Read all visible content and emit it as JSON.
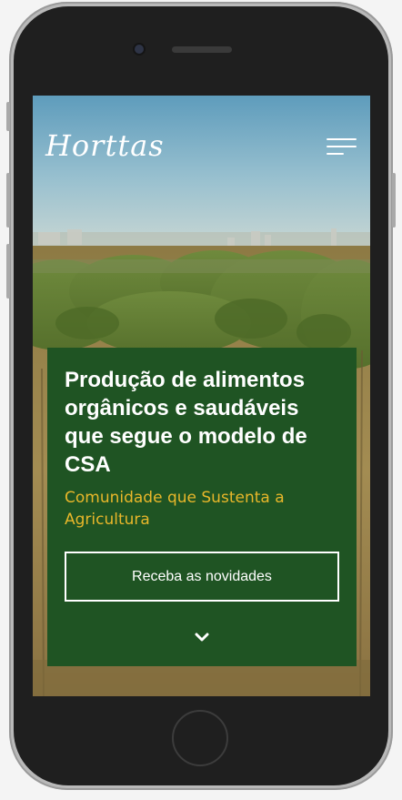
{
  "app": {
    "logo_text": "Horttas"
  },
  "header": {
    "menu_icon": "hamburger-menu-icon"
  },
  "hero": {
    "headline": "Produção de alimentos orgânicos e saudáveis que segue o modelo de CSA",
    "subtitle": "Comunidade que Sustenta a Agricultura",
    "cta_label": "Receba as novidades",
    "scroll_icon": "chevron-down-icon"
  },
  "colors": {
    "card_background": "#1f5423",
    "subtitle_accent": "#e8b72a",
    "text": "#ffffff"
  }
}
